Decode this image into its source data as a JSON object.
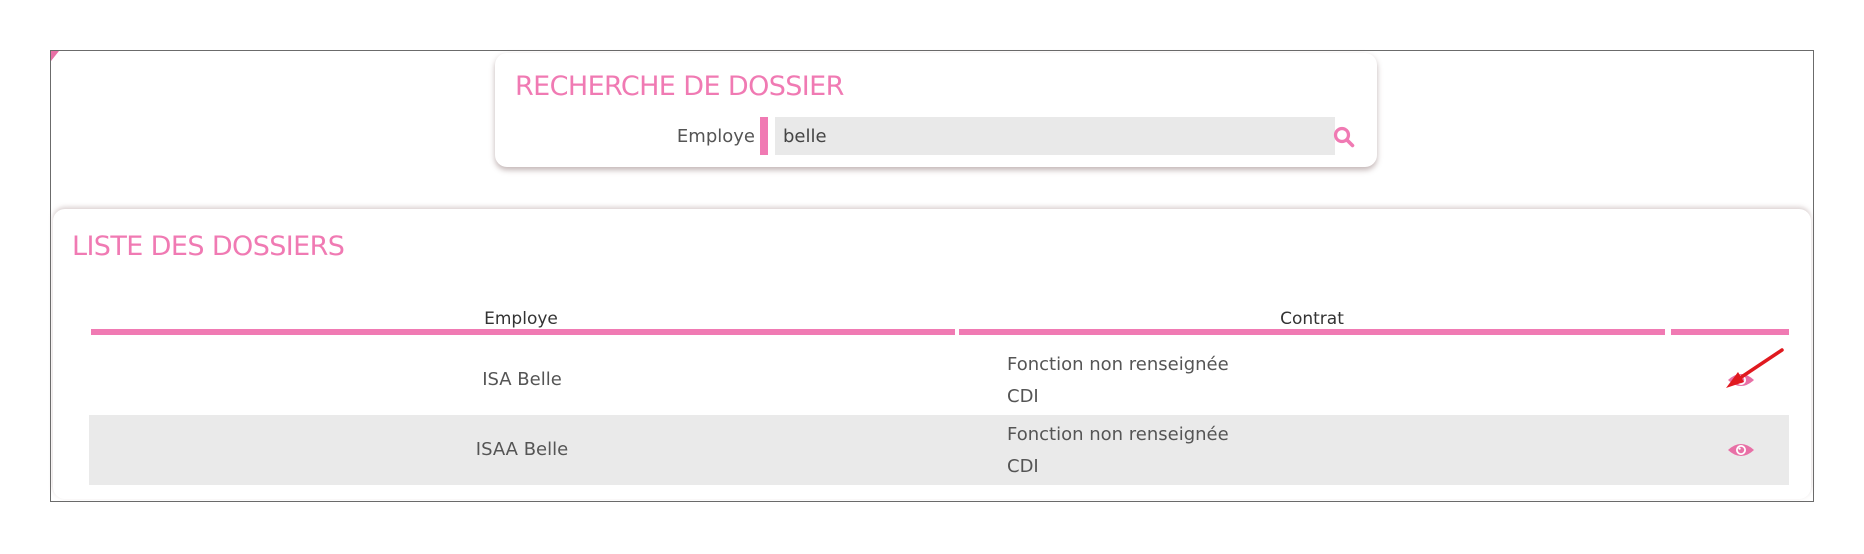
{
  "search_panel": {
    "title": "RECHERCHE DE DOSSIER",
    "employee_label": "Employe",
    "employee_value": "belle",
    "search_icon": "search-icon"
  },
  "list_panel": {
    "title": "LISTE DES DOSSIERS",
    "columns": {
      "employee": "Employe",
      "contract": "Contrat",
      "actions": ""
    },
    "rows": [
      {
        "employee": "ISA Belle",
        "function": "Fonction non renseignée",
        "contract_type": "CDI",
        "action_icon": "eye-icon"
      },
      {
        "employee": "ISAA Belle",
        "function": "Fonction non renseignée",
        "contract_type": "CDI",
        "action_icon": "eye-icon"
      }
    ]
  },
  "colors": {
    "accent": "#f07ab3",
    "row_alt": "#eaeaea",
    "annotation_arrow": "#e0191f"
  }
}
